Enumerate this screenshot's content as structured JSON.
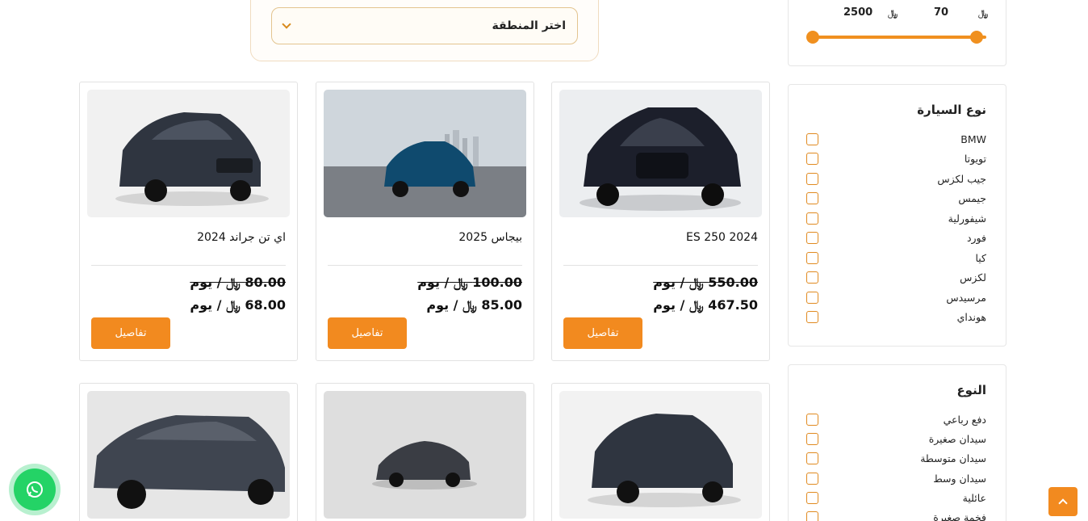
{
  "region": {
    "label": "اختر المنطقة"
  },
  "price_filter": {
    "min": "70",
    "max": "2500",
    "currency_icon": "riyal-icon",
    "range_fraction": [
      0,
      1
    ]
  },
  "car_type_filter": {
    "title": "نوع السيارة",
    "options": [
      "BMW",
      "تويوتا",
      "جيب لكزس",
      "جيمس",
      "شيفورلية",
      "فورد",
      "كيا",
      "لكزس",
      "مرسيدس",
      "هونداي"
    ]
  },
  "kind_filter": {
    "title": "النوع",
    "options": [
      "دفع رباعي",
      "سيدان صغيرة",
      "سيدان متوسطة",
      "سيدان وسط",
      "عائلية",
      "فخمة صغيرة"
    ]
  },
  "cars": [
    {
      "title": "ES 250 2024",
      "old_price": "550.00",
      "new_price": "467.50",
      "unit": "/ يوم",
      "button": "تفاصيل"
    },
    {
      "title": "بيجاس 2025",
      "old_price": "100.00",
      "new_price": "85.00",
      "unit": "/ يوم",
      "button": "تفاصيل"
    },
    {
      "title": "اي تن جراند 2024",
      "old_price": "80.00",
      "new_price": "68.00",
      "unit": "/ يوم",
      "button": "تفاصيل"
    }
  ],
  "colors": {
    "accent": "#f28a1f",
    "whatsapp": "#24d366"
  }
}
